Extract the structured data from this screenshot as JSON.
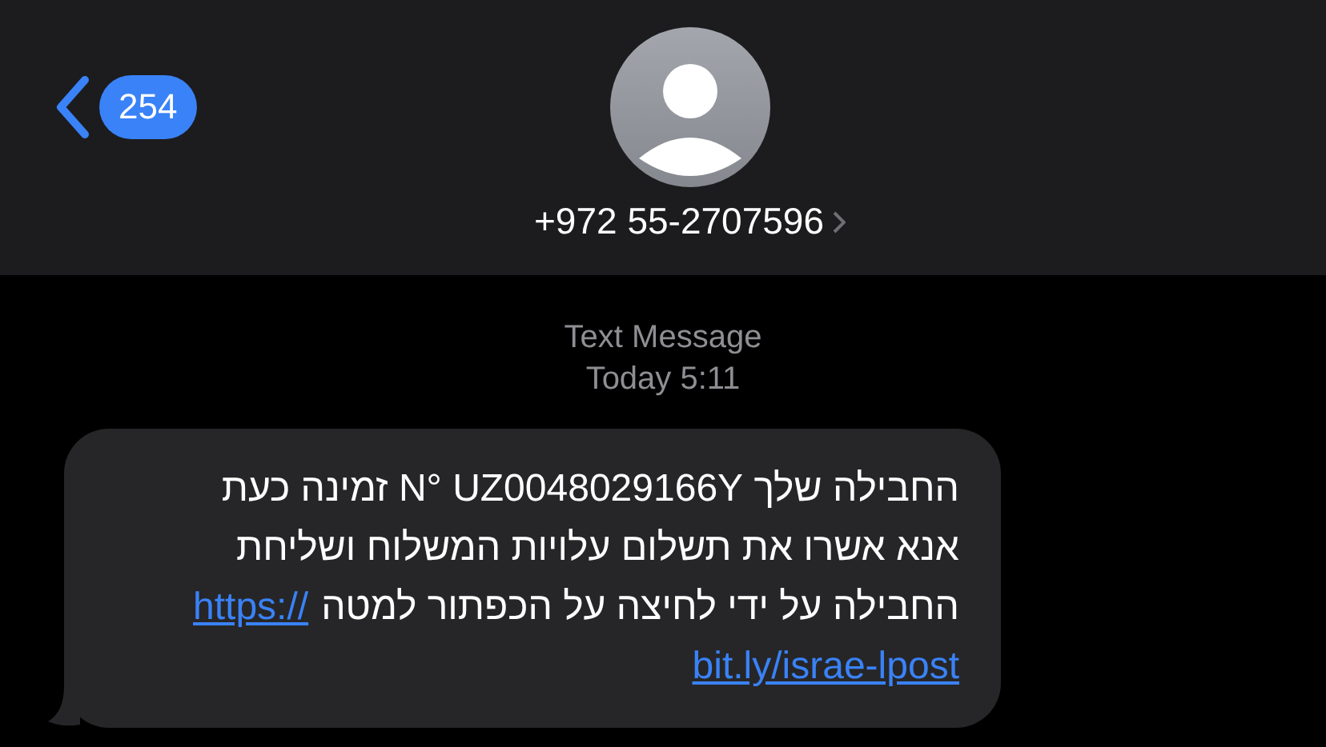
{
  "header": {
    "back_count": "254",
    "contact": "+972 55-2707596"
  },
  "meta": {
    "service": "Text Message",
    "time": "Today 5:11"
  },
  "message": {
    "lines": [
      {
        "text": "החבילה שלך N° UZ0048029166Y זמינה כעת"
      },
      {
        "text": "אנא אשרו את תשלום עלויות המשלוח ושליחת"
      },
      {
        "text": "החבילה על ידי לחיצה על הכפתור למטה",
        "link": "https://"
      },
      {
        "link": "bit.ly/israe-lpost"
      }
    ]
  }
}
